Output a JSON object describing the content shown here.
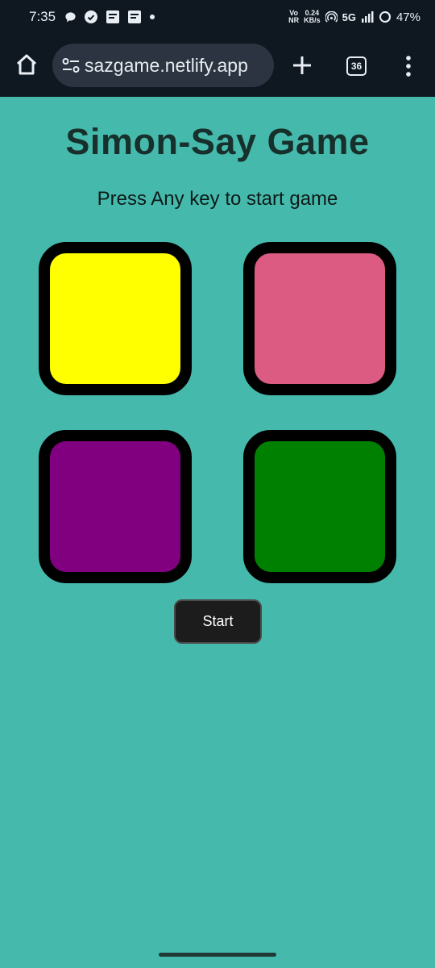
{
  "status_bar": {
    "time": "7:35",
    "network_speed": "0.24",
    "network_unit": "KB/s",
    "volte_top": "Vo",
    "volte_bottom": "NR",
    "signal": "5G",
    "battery": "47%"
  },
  "browser": {
    "url": "sazgame.netlify.app",
    "tab_count": "36"
  },
  "page": {
    "title": "Simon-Say Game",
    "subtitle": "Press Any key to start game",
    "start_label": "Start"
  },
  "game_buttons": [
    {
      "name": "yellow",
      "color": "#ffff00"
    },
    {
      "name": "pink",
      "color": "#db5b82"
    },
    {
      "name": "purple",
      "color": "#800080"
    },
    {
      "name": "green",
      "color": "#008000"
    }
  ],
  "colors": {
    "background": "#46b9ad",
    "browser_chrome": "#0f1720",
    "start_button": "#1c1c1c"
  }
}
